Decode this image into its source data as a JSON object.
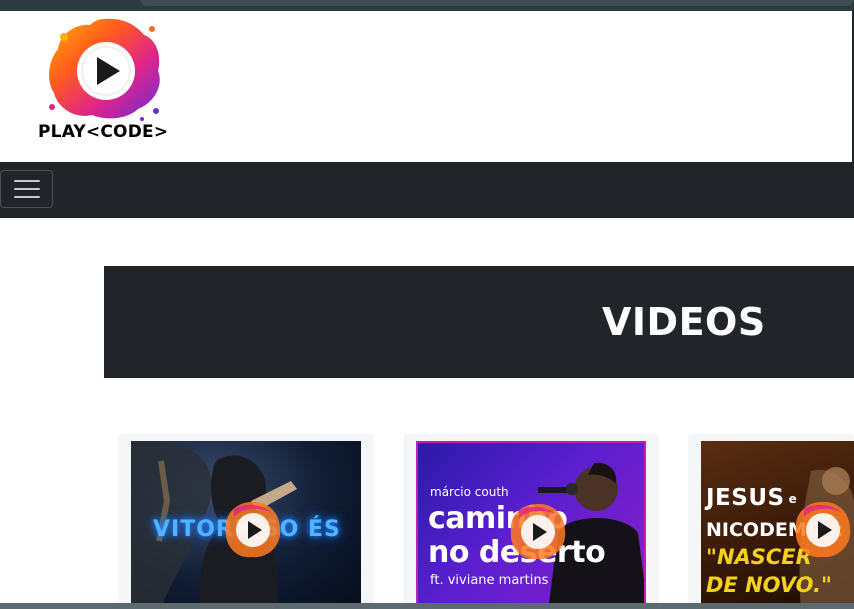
{
  "brand": {
    "logo_text": "PLAY<CODE>"
  },
  "navbar": {
    "toggler_icon": "hamburger-menu-icon"
  },
  "banner": {
    "title": "VIDEOS"
  },
  "videos": [
    {
      "lines": [
        "VITORIOSO ÉS"
      ],
      "colors": {
        "bg": "#0b1f3a",
        "text": "#4fb3ff"
      }
    },
    {
      "lines": [
        "márcio couth",
        "caminho",
        "no deserto",
        "ft. viviane martins"
      ],
      "colors": {
        "bg": "#5a1fd0",
        "text": "#ffffff"
      }
    },
    {
      "lines": [
        "JESUS",
        "e",
        "NICODEMUS:",
        "\"NASCER",
        "DE NOVO.\""
      ],
      "colors": {
        "bg": "#3a1a08",
        "text": "#ffffff",
        "accent": "#f2d21a"
      }
    }
  ],
  "colors": {
    "navbar": "#212529",
    "banner": "#212529",
    "card": "#f5f6f7"
  }
}
